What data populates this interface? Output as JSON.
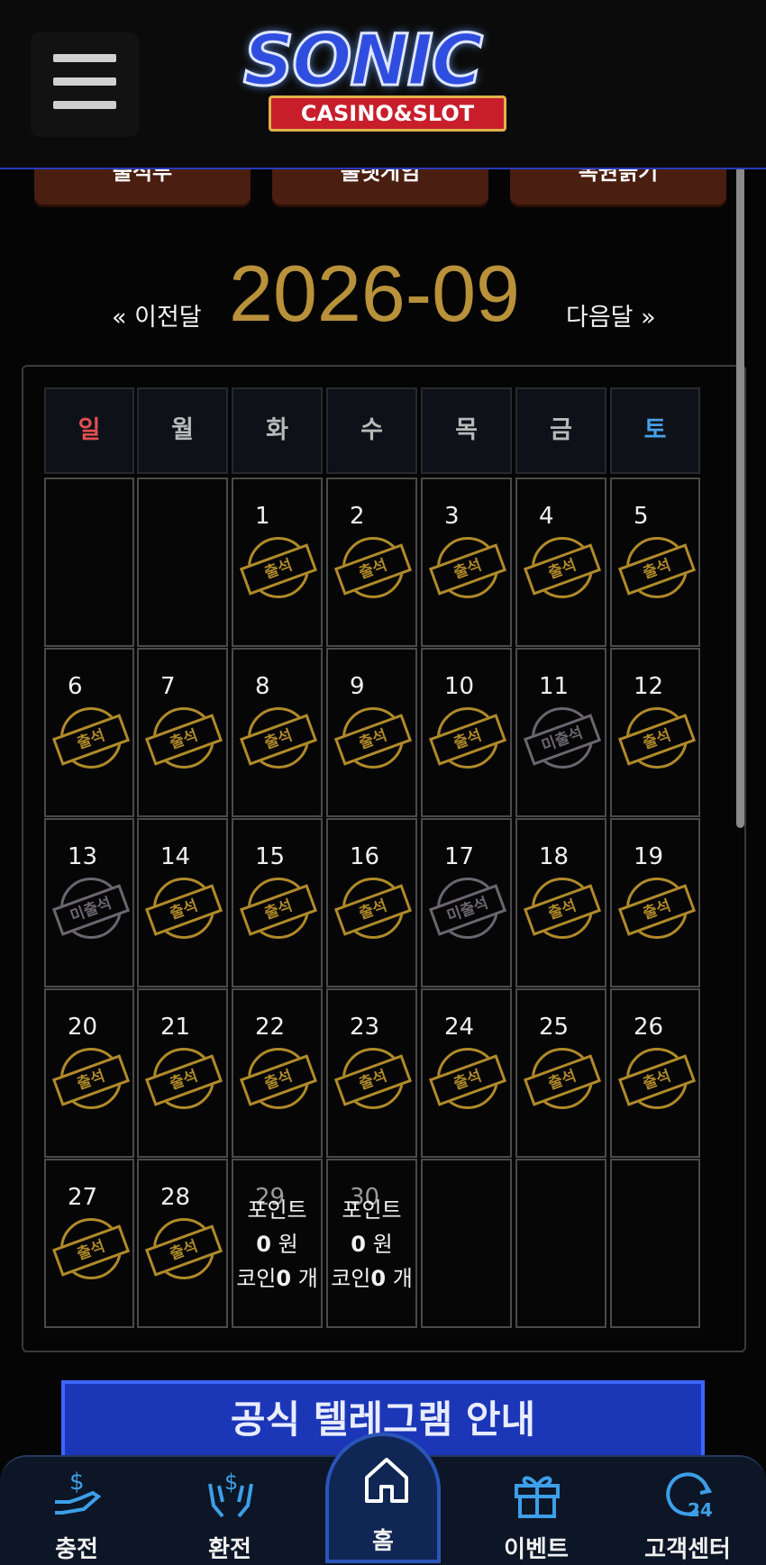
{
  "header": {
    "logo_main": "SONIC",
    "logo_sub": "CASINO&SLOT"
  },
  "tabs": [
    "출석부",
    "룰렛게임",
    "복권긁기"
  ],
  "month_nav": {
    "prev_label": "« 이전달",
    "title": "2026-09",
    "next_label": "다음달 »"
  },
  "calendar": {
    "weekdays": [
      "일",
      "월",
      "화",
      "수",
      "목",
      "금",
      "토"
    ],
    "weekday_colors": {
      "sun": "#e05050",
      "sat": "#4aa0e8",
      "default": "#b9b9b9"
    },
    "weeks": [
      [
        {
          "day": "",
          "stamp": ""
        },
        {
          "day": "",
          "stamp": ""
        },
        {
          "day": "1",
          "stamp": "출석"
        },
        {
          "day": "2",
          "stamp": "출석"
        },
        {
          "day": "3",
          "stamp": "출석"
        },
        {
          "day": "4",
          "stamp": "출석"
        },
        {
          "day": "5",
          "stamp": "출석"
        }
      ],
      [
        {
          "day": "6",
          "stamp": "출석"
        },
        {
          "day": "7",
          "stamp": "출석"
        },
        {
          "day": "8",
          "stamp": "출석"
        },
        {
          "day": "9",
          "stamp": "출석"
        },
        {
          "day": "10",
          "stamp": "출석"
        },
        {
          "day": "11",
          "stamp": "미출석"
        },
        {
          "day": "12",
          "stamp": "출석"
        }
      ],
      [
        {
          "day": "13",
          "stamp": "미출석"
        },
        {
          "day": "14",
          "stamp": "출석"
        },
        {
          "day": "15",
          "stamp": "출석"
        },
        {
          "day": "16",
          "stamp": "출석"
        },
        {
          "day": "17",
          "stamp": "미출석"
        },
        {
          "day": "18",
          "stamp": "출석"
        },
        {
          "day": "19",
          "stamp": "출석"
        }
      ],
      [
        {
          "day": "20",
          "stamp": "출석"
        },
        {
          "day": "21",
          "stamp": "출석"
        },
        {
          "day": "22",
          "stamp": "출석"
        },
        {
          "day": "23",
          "stamp": "출석"
        },
        {
          "day": "24",
          "stamp": "출석"
        },
        {
          "day": "25",
          "stamp": "출석"
        },
        {
          "day": "26",
          "stamp": "출석"
        }
      ],
      [
        {
          "day": "27",
          "stamp": "출석"
        },
        {
          "day": "28",
          "stamp": "출석"
        },
        {
          "day": "29",
          "stamp": "",
          "points": {
            "label": "포인트",
            "value": "0",
            "unit": "원",
            "coin_label": "코인",
            "coin_value": "0",
            "coin_unit": "개"
          }
        },
        {
          "day": "30",
          "stamp": "",
          "points": {
            "label": "포인트",
            "value": "0",
            "unit": "원",
            "coin_label": "코인",
            "coin_value": "0",
            "coin_unit": "개"
          }
        },
        {
          "day": "",
          "stamp": ""
        },
        {
          "day": "",
          "stamp": ""
        },
        {
          "day": "",
          "stamp": ""
        }
      ]
    ]
  },
  "banner": {
    "text": "공식 텔레그램 안내"
  },
  "bottom_nav": [
    {
      "label": "충전",
      "icon": "deposit-hand-icon"
    },
    {
      "label": "환전",
      "icon": "withdraw-hands-icon"
    },
    {
      "label": "홈",
      "icon": "home-icon"
    },
    {
      "label": "이벤트",
      "icon": "gift-icon"
    },
    {
      "label": "고객센터",
      "icon": "support-24-icon"
    }
  ],
  "colors": {
    "accent_gold": "#b8913a",
    "stamp_gold": "#b08a2a",
    "stamp_missed": "#6a6670",
    "nav_blue": "#3d9fe8"
  }
}
